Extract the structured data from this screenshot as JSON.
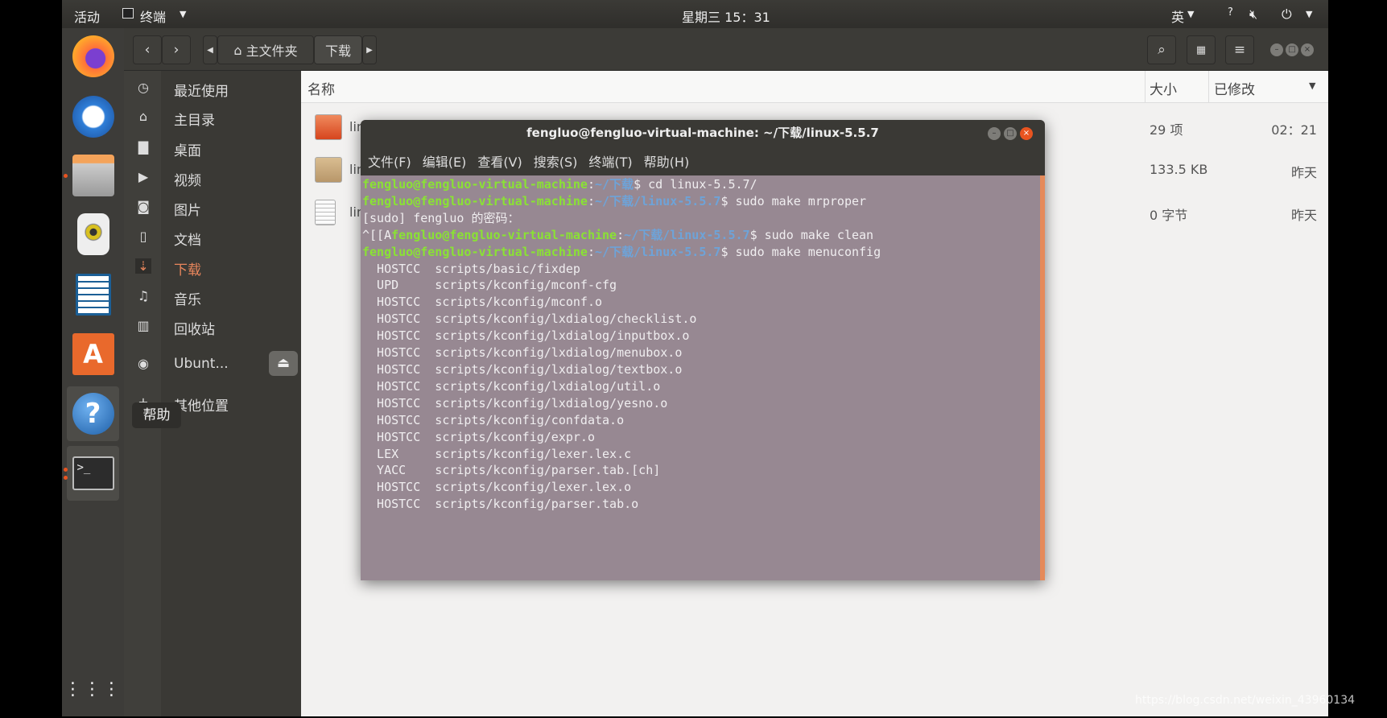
{
  "topbar": {
    "activities": "活动",
    "app_menu": "终端",
    "clock": "星期三 15：31",
    "input_method": "英"
  },
  "dock": {
    "items": [
      {
        "name": "Firefox"
      },
      {
        "name": "Thunderbird"
      },
      {
        "name": "Files"
      },
      {
        "name": "Rhythmbox"
      },
      {
        "name": "LibreOffice Writer"
      },
      {
        "name": "Ubuntu Software"
      },
      {
        "name": "Help"
      },
      {
        "name": "Terminal"
      }
    ],
    "tooltip": "帮助"
  },
  "header": {
    "breadcrumb": [
      "主文件夹",
      "下载"
    ]
  },
  "sidebar": {
    "items": [
      {
        "icon": "clock",
        "label": "最近使用"
      },
      {
        "icon": "home",
        "label": "主目录"
      },
      {
        "icon": "folder",
        "label": "桌面"
      },
      {
        "icon": "video",
        "label": "视频"
      },
      {
        "icon": "camera",
        "label": "图片"
      },
      {
        "icon": "document",
        "label": "文档"
      },
      {
        "icon": "download",
        "label": "下载"
      },
      {
        "icon": "music",
        "label": "音乐"
      },
      {
        "icon": "trash",
        "label": "回收站"
      },
      {
        "icon": "disc",
        "label": "Ubunt..."
      },
      {
        "icon": "plus",
        "label": "其他位置"
      }
    ]
  },
  "files": {
    "columns": {
      "name": "名称",
      "size": "大小",
      "modified": "已修改"
    },
    "rows": [
      {
        "name": "linux-5.5.7",
        "size": "29 项",
        "modified": "02：21"
      },
      {
        "name": "linux-5.5.7.tar.gz",
        "size": "133.5 KB",
        "modified": "昨天"
      },
      {
        "name": "linux-5.5.7.tar.xz",
        "size": "0 字节",
        "modified": "昨天"
      }
    ]
  },
  "terminal": {
    "title": "fengluo@fengluo-virtual-machine: ~/下载/linux-5.5.7",
    "menu": [
      "文件(F)",
      "编辑(E)",
      "查看(V)",
      "搜索(S)",
      "终端(T)",
      "帮助(H)"
    ],
    "user": "fengluo@fengluo-virtual-machine",
    "lines": [
      {
        "pre": "",
        "path": "~/下载",
        "cmd": "$ cd linux-5.5.7/"
      },
      {
        "pre": "",
        "path": "~/下载/linux-5.5.7",
        "cmd": "$ sudo make mrproper"
      },
      {
        "text": "[sudo] fengluo 的密码："
      },
      {
        "pre": "^[[A",
        "path": "~/下载/linux-5.5.7",
        "cmd": "$ sudo make clean"
      },
      {
        "pre": "",
        "path": "~/下载/linux-5.5.7",
        "cmd": "$ sudo make menuconfig"
      },
      {
        "text": "  HOSTCC  scripts/basic/fixdep"
      },
      {
        "text": "  UPD     scripts/kconfig/mconf-cfg"
      },
      {
        "text": "  HOSTCC  scripts/kconfig/mconf.o"
      },
      {
        "text": "  HOSTCC  scripts/kconfig/lxdialog/checklist.o"
      },
      {
        "text": "  HOSTCC  scripts/kconfig/lxdialog/inputbox.o"
      },
      {
        "text": "  HOSTCC  scripts/kconfig/lxdialog/menubox.o"
      },
      {
        "text": "  HOSTCC  scripts/kconfig/lxdialog/textbox.o"
      },
      {
        "text": "  HOSTCC  scripts/kconfig/lxdialog/util.o"
      },
      {
        "text": "  HOSTCC  scripts/kconfig/lxdialog/yesno.o"
      },
      {
        "text": "  HOSTCC  scripts/kconfig/confdata.o"
      },
      {
        "text": "  HOSTCC  scripts/kconfig/expr.o"
      },
      {
        "text": "  LEX     scripts/kconfig/lexer.lex.c"
      },
      {
        "text": "  YACC    scripts/kconfig/parser.tab.[ch]"
      },
      {
        "text": "  HOSTCC  scripts/kconfig/lexer.lex.o"
      },
      {
        "text": "  HOSTCC  scripts/kconfig/parser.tab.o"
      }
    ]
  },
  "watermark": "https://blog.csdn.net/weixin_43960134",
  "colors": {
    "accent": "#e95420",
    "terminal_bg": "#978892",
    "prompt_user": "#8ae234",
    "prompt_path": "#6ea3d8"
  }
}
